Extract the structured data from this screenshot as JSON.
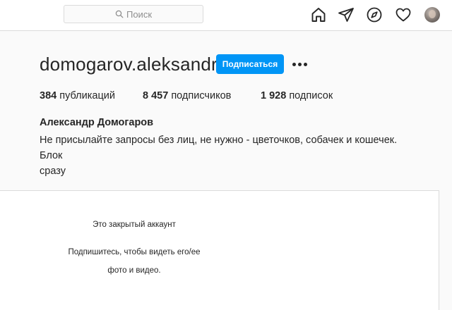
{
  "header": {
    "search_placeholder": "Поиск",
    "icons": [
      "home-icon",
      "direct-icon",
      "explore-icon",
      "activity-icon",
      "profile-avatar"
    ]
  },
  "profile": {
    "username": "domogarov.aleksandr",
    "follow_label": "Подписаться",
    "stats": [
      {
        "count": "384",
        "label": "публикаций"
      },
      {
        "count": "8 457",
        "label": "подписчиков"
      },
      {
        "count": "1 928",
        "label": "подписок"
      }
    ],
    "full_name": "Александр Домогаров",
    "bio_line1": "Не присылайте запросы без лиц, не нужно - цветочков, собачек и кошечек. Блок",
    "bio_line2": "сразу"
  },
  "private": {
    "title": "Это закрытый аккаунт",
    "subtitle_line1": "Подпишитесь, чтобы видеть его/ее",
    "subtitle_line2": "фото и видео."
  },
  "colors": {
    "accent": "#0095f6",
    "background": "#fafafa",
    "border": "#dbdbdb",
    "text": "#262626"
  }
}
